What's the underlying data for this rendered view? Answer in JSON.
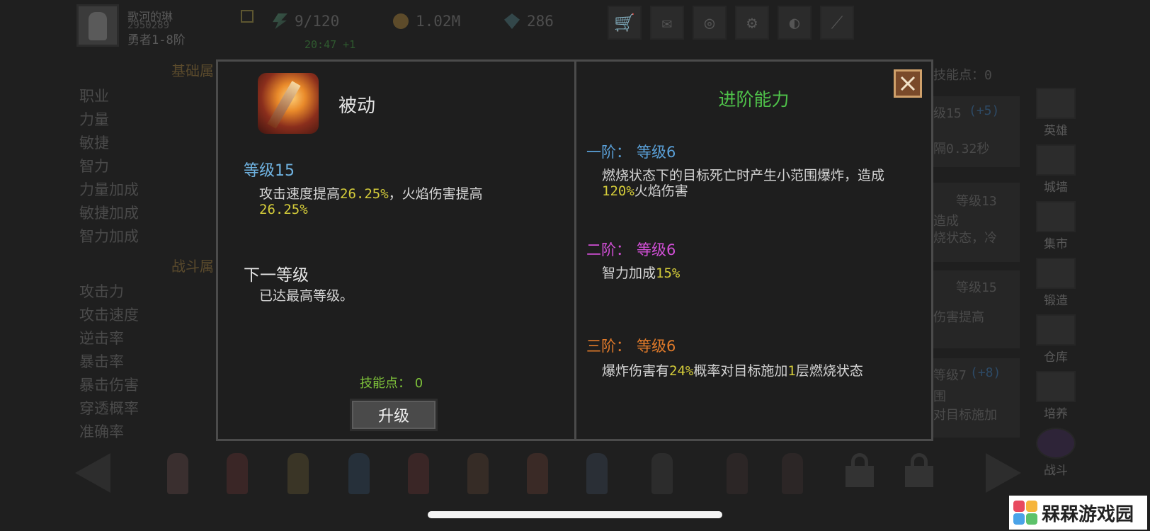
{
  "hud": {
    "player_name": "歌河的琳",
    "player_id": "2950289",
    "player_rank": "勇者1-8阶",
    "energy": "9/120",
    "energy_timer": "20:47 +1",
    "gold": "1.02M",
    "gems": "286",
    "toolbar": [
      "shop-cart-icon",
      "mail-icon",
      "gamepad-icon",
      "settings-gear-icon",
      "color-wheel-icon",
      "sword-icon"
    ]
  },
  "left_panel": {
    "section_basic": "基础属",
    "basic_stats": [
      "职业",
      "力量",
      "敏捷",
      "智力",
      "力量加成",
      "敏捷加成",
      "智力加成"
    ],
    "section_combat": "战斗属",
    "combat_stats": [
      "攻击力",
      "攻击速度",
      "逆击率",
      "暴击率",
      "暴击伤害",
      "穿透概率",
      "准确率"
    ]
  },
  "sidebar": {
    "items": [
      {
        "label": "英雄",
        "icon": "hero-helmet-icon"
      },
      {
        "label": "城墙",
        "icon": "wall-icon"
      },
      {
        "label": "集市",
        "icon": "market-icon"
      },
      {
        "label": "锻造",
        "icon": "anvil-icon"
      },
      {
        "label": "仓库",
        "icon": "warehouse-icon"
      },
      {
        "label": "培养",
        "icon": "train-icon"
      },
      {
        "label": "战斗",
        "icon": "battle-portal-icon"
      }
    ]
  },
  "background_text": {
    "skill_points_top": "技能点：0",
    "row1_level": "级15",
    "row1_bonus": "(+5)",
    "row1_desc": "隔0.32秒",
    "row2_level": "等级13",
    "row2_desc1": "造成",
    "row2_desc2": "烧状态，冷",
    "row3_level": "等级15",
    "row3_desc": "伤害提高",
    "row4_level": "等级7",
    "row4_bonus": "(+8)",
    "row4_desc1": "围",
    "row4_desc2": "对目标施加"
  },
  "modal": {
    "skill_icon": "flaming-sword-skill-icon",
    "skill_type": "被动",
    "level_label": "等级15",
    "desc_part1": "攻击速度提高",
    "desc_val1": "26.25%",
    "desc_part2": "，火焰伤害提高",
    "desc_val2": "26.25%",
    "next_level_label": "下一等级",
    "next_level_desc": "已达最高等级。",
    "skill_points_label": "技能点：",
    "skill_points_value": "0",
    "upgrade_button": "升级",
    "advanced_title": "进阶能力",
    "tiers": [
      {
        "name": "一阶：",
        "level": "等级6",
        "desc_a": "燃烧状态下的目标死亡时产生小范围爆炸，造成",
        "val1": "120%",
        "desc_b": "火焰伤害",
        "val2": "",
        "desc_c": ""
      },
      {
        "name": "二阶：",
        "level": "等级6",
        "desc_a": "智力加成",
        "val1": "15%",
        "desc_b": "",
        "val2": "",
        "desc_c": ""
      },
      {
        "name": "三阶：",
        "level": "等级6",
        "desc_a": "爆炸伤害有",
        "val1": "24%",
        "desc_b": "概率对目标施加",
        "val2": "1",
        "desc_c": "层燃烧状态"
      }
    ],
    "close_icon": "close-x-icon",
    "colors": {
      "level_blue": "#6fb2e0",
      "highlight_yellow": "#d4cc3a",
      "green": "#4fc24a",
      "tier2_magenta": "#d14fd6",
      "tier3_orange": "#e07a2a"
    }
  },
  "bottom": {
    "hero_count": 12,
    "locked_slots": 2
  },
  "watermark": {
    "text": "槑槑游戏园"
  }
}
